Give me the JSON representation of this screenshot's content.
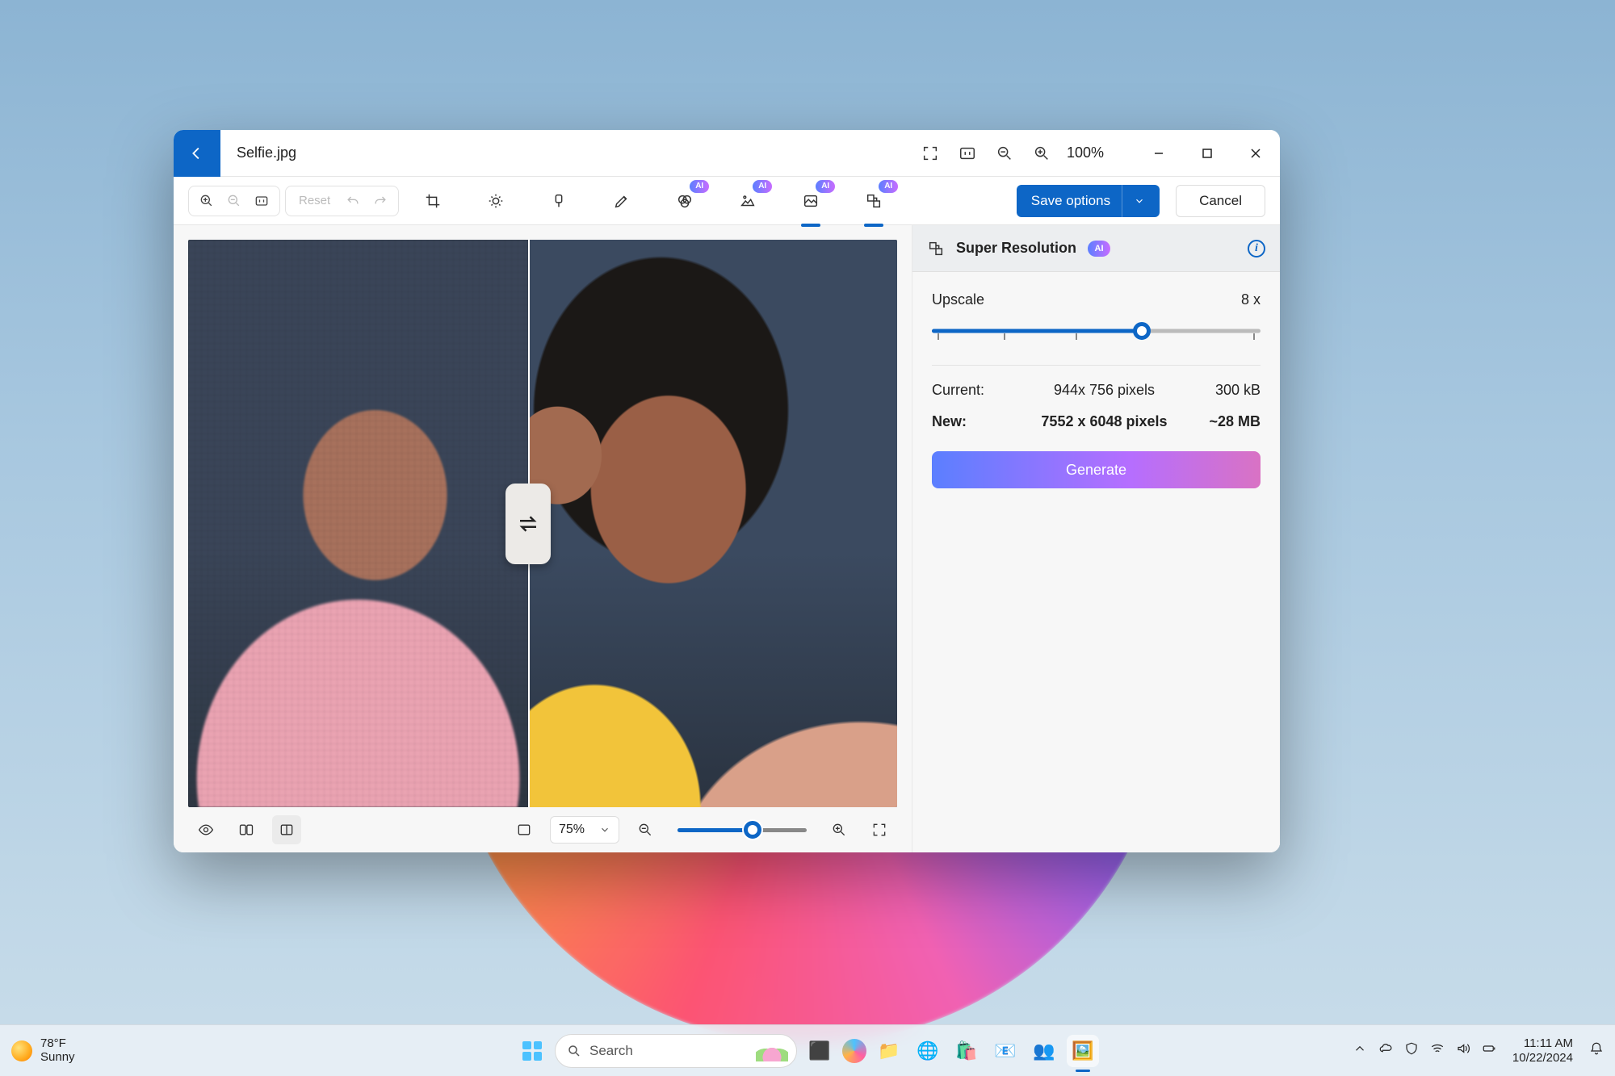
{
  "titlebar": {
    "filename": "Selfie.jpg",
    "zoom": "100%"
  },
  "toolbar": {
    "reset_label": "Reset",
    "save_label": "Save options",
    "cancel_label": "Cancel",
    "ai_badge": "AI"
  },
  "footer": {
    "zoom_select": "75%"
  },
  "panel": {
    "title": "Super Resolution",
    "ai_badge": "AI",
    "upscale_label": "Upscale",
    "upscale_value": "8 x",
    "current_label": "Current:",
    "current_dim": "944x 756 pixels",
    "current_size": "300 kB",
    "new_label": "New:",
    "new_dim": "7552 x 6048 pixels",
    "new_size": "~28 MB",
    "generate_label": "Generate"
  },
  "taskbar": {
    "weather_temp": "78°F",
    "weather_cond": "Sunny",
    "search_placeholder": "Search",
    "time": "11:11 AM",
    "date": "10/22/2024"
  }
}
